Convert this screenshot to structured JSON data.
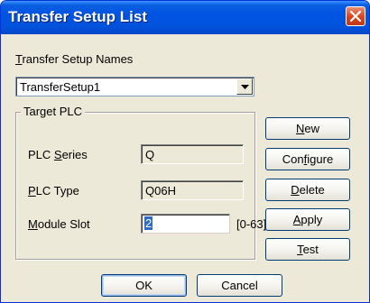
{
  "window": {
    "title": "Transfer Setup List",
    "close_icon": "close-icon"
  },
  "setup_names": {
    "label_mnemonic": "T",
    "label_rest": "ransfer Setup Names",
    "selected_value": "TransferSetup1"
  },
  "target_plc": {
    "legend": "Target PLC",
    "plc_series": {
      "label_pre": "PLC ",
      "label_mnemonic": "S",
      "label_post": "eries",
      "value": "Q"
    },
    "plc_type": {
      "label_mnemonic": "P",
      "label_post": "LC Type",
      "value": "Q06H"
    },
    "module_slot": {
      "label_mnemonic": "M",
      "label_post": "odule Slot",
      "value": "2",
      "range": "[0-63]"
    }
  },
  "side_buttons": {
    "new": {
      "mnemonic": "N",
      "rest": "ew"
    },
    "configure": {
      "pre": "Con",
      "mnemonic": "f",
      "rest": "igure"
    },
    "delete": {
      "mnemonic": "D",
      "rest": "elete"
    },
    "apply": {
      "mnemonic": "A",
      "rest": "pply"
    },
    "test": {
      "mnemonic": "T",
      "rest": "est"
    }
  },
  "footer": {
    "ok_label": "OK",
    "cancel_label": "Cancel"
  },
  "colors": {
    "titlebar": "#0054e3",
    "close_button": "#d6421f",
    "dialog_background": "#ece9d8",
    "selection": "#316ac5"
  }
}
